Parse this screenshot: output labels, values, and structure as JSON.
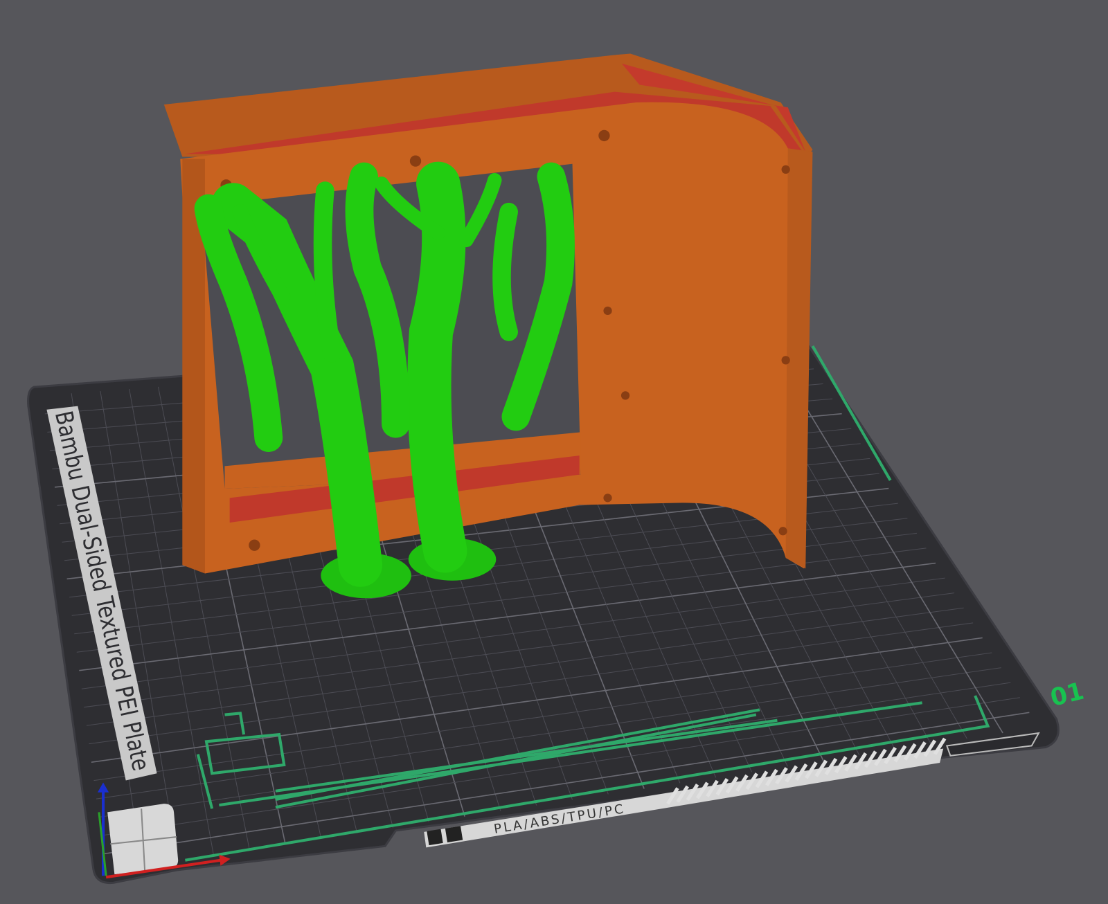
{
  "viewport": {
    "plate_name": "Bambu Dual-Sided Textured PEI Plate",
    "plate_number": "01",
    "plate_materials": "PLA/ABS/TPU/PC"
  },
  "colors": {
    "background": "#56565b",
    "plate": "#2e2e32",
    "grid": "#55555c",
    "model_orange": "#c8621f",
    "model_red": "#c0392b",
    "support_green": "#22cc11",
    "plate_marking_green": "#2fa86a",
    "plate_number_green": "#18c250"
  }
}
